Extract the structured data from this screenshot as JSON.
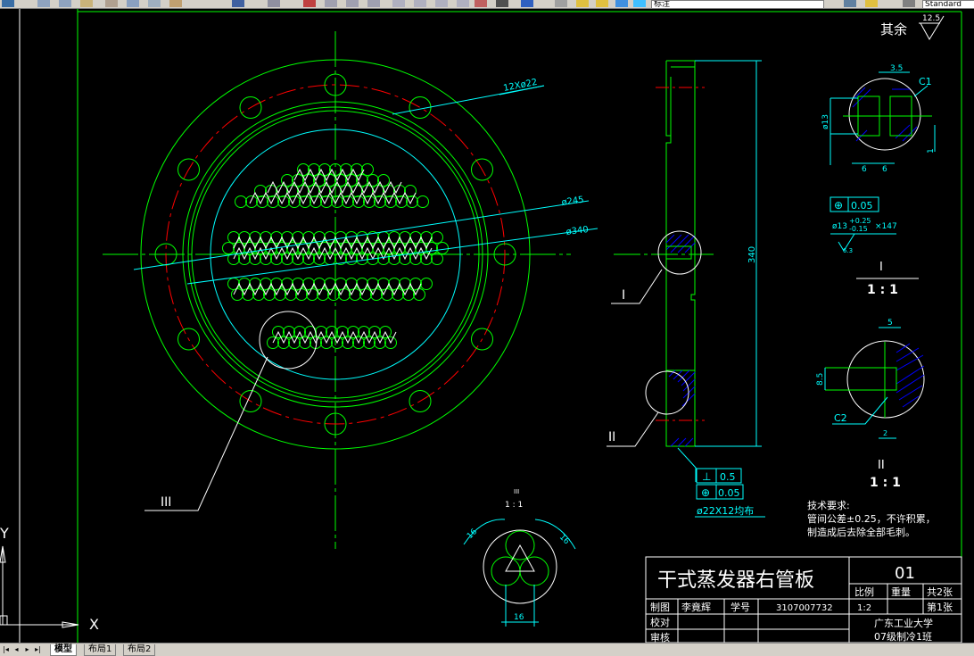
{
  "toolbar": {
    "layer_name": "标注",
    "text_style": "Standard"
  },
  "roughness": {
    "note": "其余",
    "value": "12.5"
  },
  "main_view": {
    "callout_holes": "12Xø22",
    "callout_d245": "ø245",
    "callout_d340": "ø340",
    "label_III": "III"
  },
  "side_view": {
    "label_I": "I",
    "label_II": "II",
    "dim_340": "340",
    "tol_perp": "0.5",
    "tol_pos": "0.05",
    "hole_note": "ø22X12均布"
  },
  "detail_I": {
    "dim_35": "3.5",
    "dim_c1": "C1",
    "dim_13": "ø13",
    "dim_6a": "6",
    "dim_6b": "6",
    "dim_1": "1",
    "tol": "0.05",
    "tube_note": "ø13",
    "tube_tol_upper": "+0.25",
    "tube_tol_lower": "-0.15",
    "tube_count": "×147",
    "rough": "6.3",
    "title": "I",
    "scale": "1 : 1"
  },
  "detail_II": {
    "dim_5": "5",
    "dim_85": "8.5",
    "dim_c2": "C2",
    "dim_2": "2",
    "title": "II",
    "scale": "1 : 1"
  },
  "detail_III": {
    "title": "III",
    "scale": "1 : 1",
    "dim_16a": "16",
    "dim_16b": "16",
    "dim_16c": "16"
  },
  "notes": {
    "heading": "技术要求:",
    "line1": "管间公差±0.25，不许积累，",
    "line2": "制造成后去除全部毛刺。"
  },
  "title_block": {
    "title": "干式蒸发器右管板",
    "drawing_no": "01",
    "h_scale": "比例",
    "h_weight": "重量",
    "sheets_total": "共2张",
    "drawn_label": "制图",
    "drawn_name": "李竟辉",
    "student_label": "学号",
    "student_no": "3107007732",
    "scale_value": "1:2",
    "sheet_no": "第1张",
    "check_label": "校对",
    "review_label": "审核",
    "school": "广东工业大学",
    "class": "07级制冷1班"
  },
  "ucs": {
    "x": "X",
    "y": "Y"
  },
  "tabs": {
    "model": "模型",
    "layout1": "布局1",
    "layout2": "布局2"
  },
  "colors": {
    "green": "#00ff00",
    "cyan": "#00ffff",
    "red": "#ff0000",
    "white": "#ffffff",
    "blue": "#0000ff"
  }
}
